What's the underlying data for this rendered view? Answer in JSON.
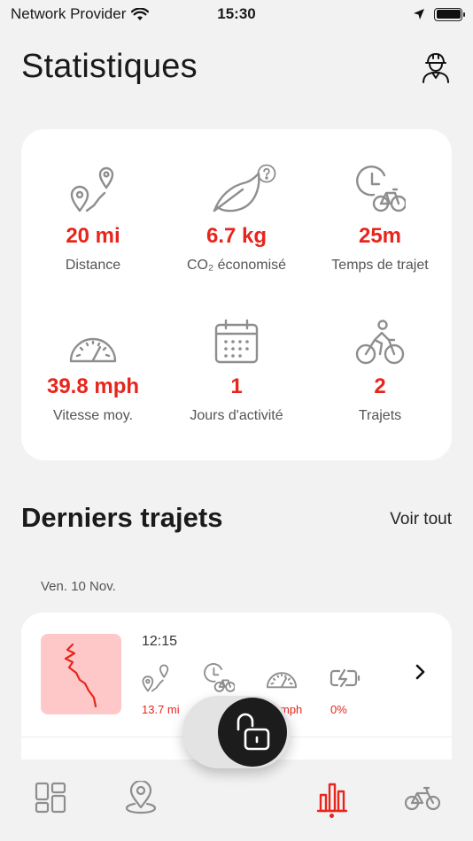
{
  "status_bar": {
    "carrier": "Network Provider",
    "time": "15:30",
    "battery_level": 1.0
  },
  "header": {
    "title": "Statistiques",
    "profile_icon": "user-helmet-icon"
  },
  "stats": [
    {
      "icon": "distance-route-icon",
      "value": "20 mi",
      "label": "Distance"
    },
    {
      "icon": "leaf-icon",
      "value": "6.7 kg",
      "label": "CO₂ économisé",
      "help": true
    },
    {
      "icon": "clock-bike-icon",
      "value": "25m",
      "label": "Temps de trajet"
    },
    {
      "icon": "speedometer-icon",
      "value": "39.8 mph",
      "label": "Vitesse moy."
    },
    {
      "icon": "calendar-icon",
      "value": "1",
      "label": "Jours d'activité"
    },
    {
      "icon": "cyclist-icon",
      "value": "2",
      "label": "Trajets"
    }
  ],
  "recent_trips": {
    "title": "Derniers trajets",
    "see_all": "Voir tout",
    "groups": [
      {
        "date": "Ven. 10 Nov.",
        "trips": [
          {
            "time": "12:15",
            "distance": "13.7 mi",
            "duration": "",
            "speed": "mph",
            "battery": "0%"
          }
        ]
      }
    ]
  },
  "tab_bar": {
    "tabs": [
      "dashboard-icon",
      "map-pin-icon",
      "statistics-icon",
      "bike-icon"
    ],
    "active": "statistics-icon"
  },
  "lock": {
    "state": "unlocked",
    "icon": "unlocked-padlock-icon"
  },
  "colors": {
    "accent": "#e8251c",
    "background": "#f2f2f2",
    "card": "#ffffff",
    "icon_gray": "#8e8e8e",
    "map_tint": "#ffc8c8"
  }
}
